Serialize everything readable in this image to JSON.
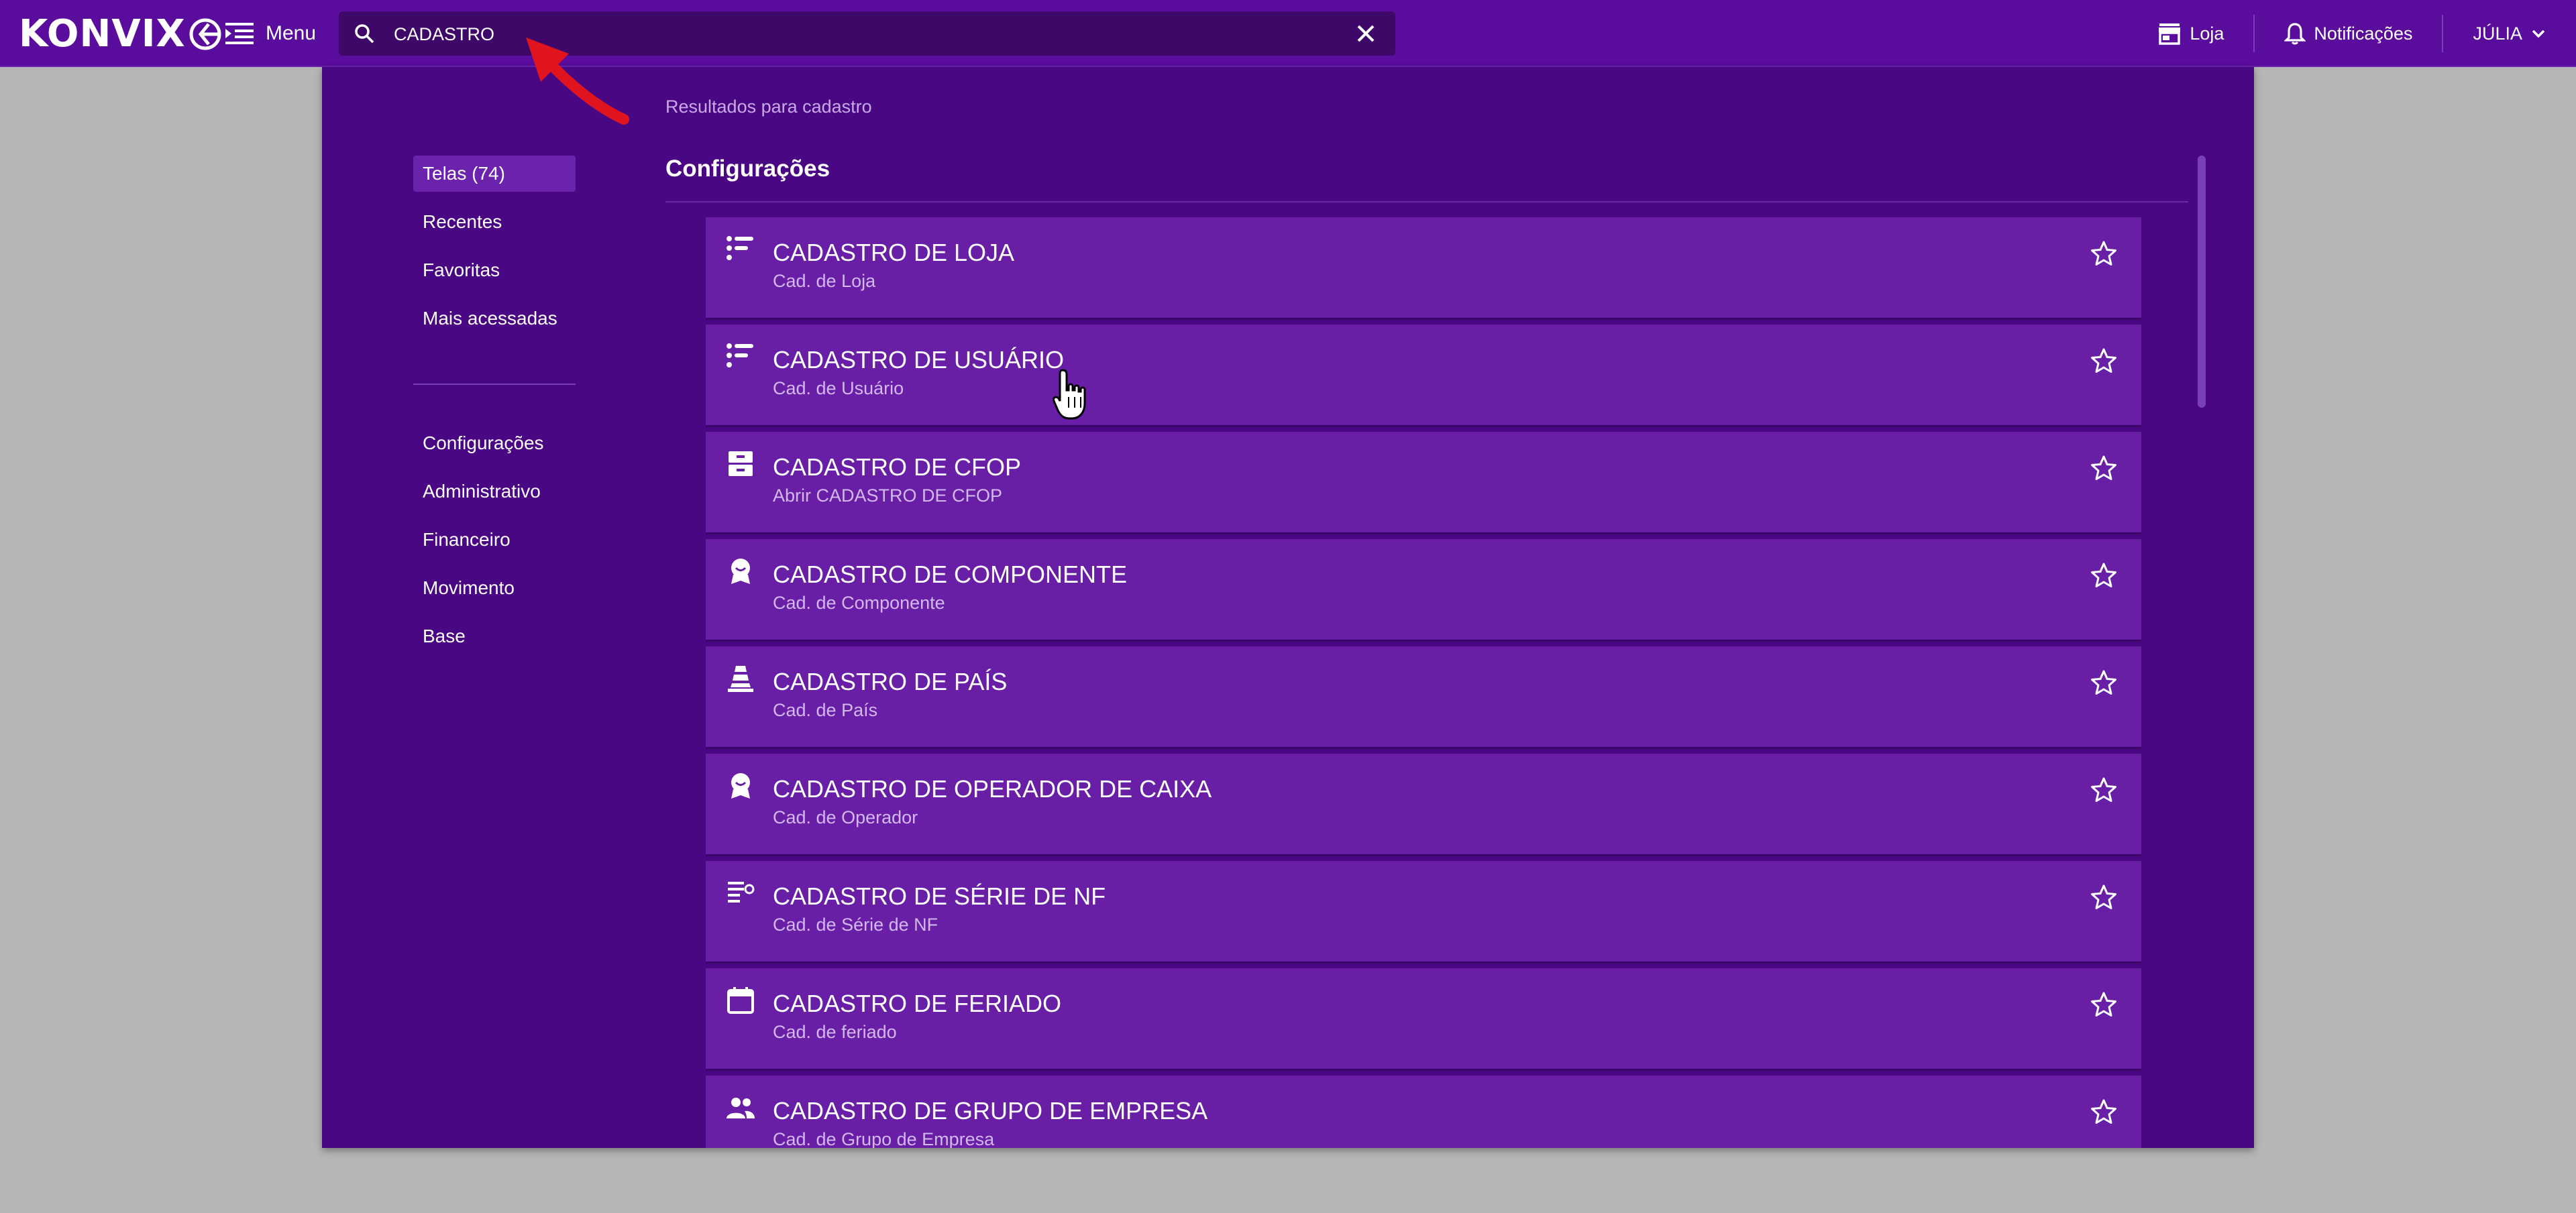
{
  "topbar": {
    "logo_text": "KONVIX",
    "menu_label": "Menu",
    "search_value": "CADASTRO",
    "store_label": "Loja",
    "notifications_label": "Notificações",
    "user_label": "JÚLIA",
    "brand_color": "#5a0c9c"
  },
  "panel": {
    "results_label": "Resultados para cadastro",
    "section_title": "Configurações"
  },
  "sidebar": {
    "groups": [
      "Telas (74)",
      "Recentes",
      "Favoritas",
      "Mais acessadas"
    ],
    "categories": [
      "Configurações",
      "Administrativo",
      "Financeiro",
      "Movimento",
      "Base"
    ]
  },
  "results": [
    {
      "title": "CADASTRO DE LOJA",
      "subtitle": "Cad. de Loja",
      "icon": "list-icon"
    },
    {
      "title": "CADASTRO DE USUÁRIO",
      "subtitle": "Cad. de Usuário",
      "icon": "list-icon"
    },
    {
      "title": "CADASTRO DE CFOP",
      "subtitle": "Abrir CADASTRO DE CFOP",
      "icon": "archive-icon"
    },
    {
      "title": "CADASTRO DE COMPONENTE",
      "subtitle": "Cad. de Componente",
      "icon": "badge-icon"
    },
    {
      "title": "CADASTRO DE PAÍS",
      "subtitle": "Cad. de País",
      "icon": "cone-icon"
    },
    {
      "title": "CADASTRO DE OPERADOR DE CAIXA",
      "subtitle": "Cad. de Operador",
      "icon": "badge-icon"
    },
    {
      "title": "CADASTRO DE SÉRIE DE NF",
      "subtitle": "Cad. de Série de NF",
      "icon": "list-settings-icon"
    },
    {
      "title": "CADASTRO DE FERIADO",
      "subtitle": "Cad. de feriado",
      "icon": "calendar-icon"
    },
    {
      "title": "CADASTRO DE GRUPO DE EMPRESA",
      "subtitle": "Cad. de Grupo de Empresa",
      "icon": "group-icon"
    }
  ]
}
